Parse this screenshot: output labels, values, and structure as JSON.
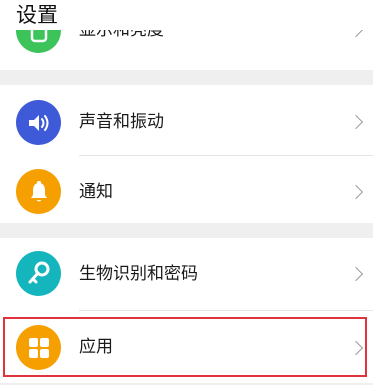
{
  "header": {
    "title": "设置"
  },
  "rows": [
    {
      "label": "显示和亮度",
      "icon": "display-brightness-icon",
      "color": "#3cc35a"
    },
    {
      "label": "声音和振动",
      "icon": "sound-icon",
      "color": "#3f5ad8"
    },
    {
      "label": "通知",
      "icon": "bell-icon",
      "color": "#f5a000"
    },
    {
      "label": "生物识别和密码",
      "icon": "key-icon",
      "color": "#15b5be"
    },
    {
      "label": "应用",
      "icon": "apps-grid-icon",
      "color": "#f5a000"
    }
  ],
  "highlight_color": "#e0343c"
}
